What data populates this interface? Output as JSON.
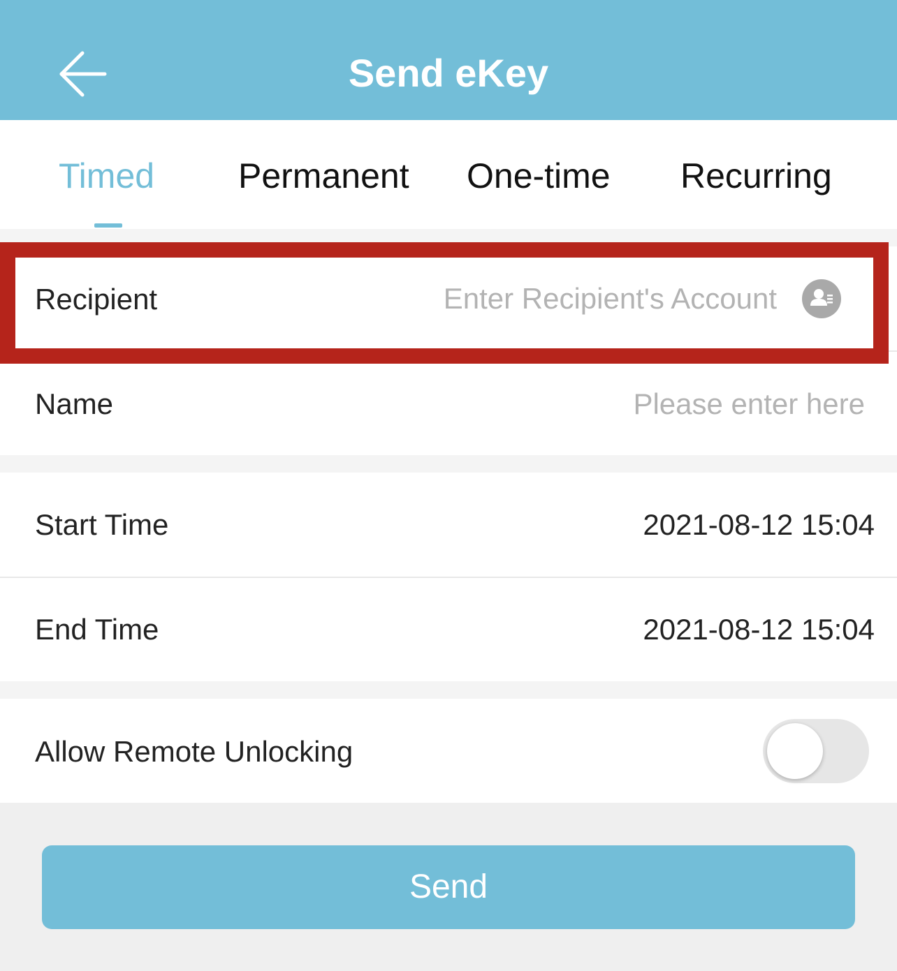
{
  "header": {
    "title": "Send eKey",
    "back_icon": "arrow-left-icon"
  },
  "tabs": [
    {
      "label": "Timed",
      "active": true
    },
    {
      "label": "Permanent",
      "active": false
    },
    {
      "label": "One-time",
      "active": false
    },
    {
      "label": "Recurring",
      "active": false
    }
  ],
  "form": {
    "recipient": {
      "label": "Recipient",
      "placeholder": "Enter Recipient's Account",
      "value": "",
      "icon": "contact-book-icon"
    },
    "name": {
      "label": "Name",
      "placeholder": "Please enter here",
      "value": ""
    },
    "start_time": {
      "label": "Start Time",
      "value": "2021-08-12 15:04"
    },
    "end_time": {
      "label": "End Time",
      "value": "2021-08-12 15:04"
    },
    "allow_remote_unlocking": {
      "label": "Allow Remote Unlocking",
      "enabled": false
    }
  },
  "send_button": {
    "label": "Send"
  },
  "colors": {
    "accent": "#73bed8",
    "highlight": "#b5241b",
    "placeholder": "#b3b3b3"
  }
}
